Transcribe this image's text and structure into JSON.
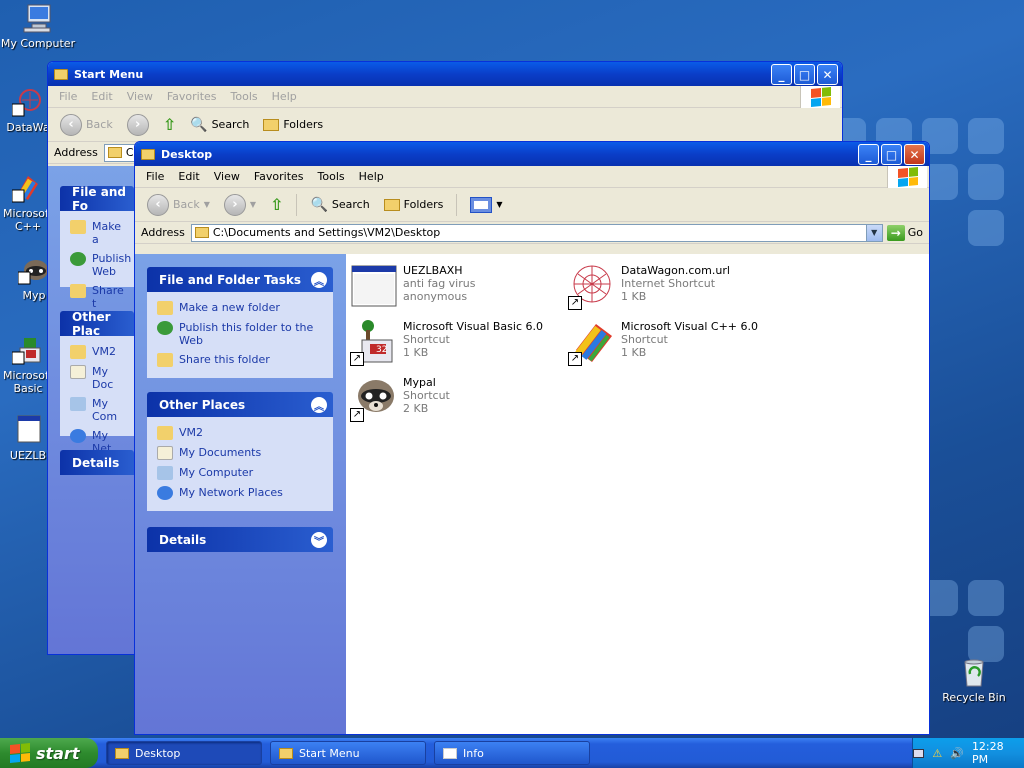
{
  "desktop": {
    "icons": [
      {
        "label": "My Computer"
      },
      {
        "label": "DataWa"
      },
      {
        "label": "Microsoft C++"
      },
      {
        "label": "Myp"
      },
      {
        "label": "Microsoft Basic"
      },
      {
        "label": "UEZLB"
      },
      {
        "label": "Recycle Bin"
      }
    ]
  },
  "startmenu_window": {
    "title": "Start Menu",
    "menu": [
      "File",
      "Edit",
      "View",
      "Favorites",
      "Tools",
      "Help"
    ],
    "toolbar": {
      "back": "Back",
      "search": "Search",
      "folders": "Folders"
    },
    "address_label": "Address",
    "address_value": "C:",
    "panes": {
      "file_tasks": "File and Fo",
      "items": [
        "Make a",
        "Publish Web",
        "Share t"
      ],
      "other_places": "Other Plac",
      "places": [
        "VM2",
        "My Doc",
        "My Com",
        "My Net"
      ],
      "details": "Details"
    }
  },
  "desktop_window": {
    "title": "Desktop",
    "menu": [
      "File",
      "Edit",
      "View",
      "Favorites",
      "Tools",
      "Help"
    ],
    "toolbar": {
      "back": "Back",
      "search": "Search",
      "folders": "Folders"
    },
    "address_label": "Address",
    "address_value": "C:\\Documents and Settings\\VM2\\Desktop",
    "go_label": "Go",
    "file_tasks": {
      "title": "File and Folder Tasks",
      "items": [
        "Make a new folder",
        "Publish this folder to the Web",
        "Share this folder"
      ]
    },
    "other_places": {
      "title": "Other Places",
      "items": [
        "VM2",
        "My Documents",
        "My Computer",
        "My Network Places"
      ]
    },
    "details": {
      "title": "Details"
    },
    "files": [
      {
        "name": "UEZLBAXH",
        "line2": "anti fag virus",
        "line3": "anonymous"
      },
      {
        "name": "DataWagon.com.url",
        "line2": "Internet Shortcut",
        "line3": "1 KB"
      },
      {
        "name": "Microsoft Visual Basic 6.0",
        "line2": "Shortcut",
        "line3": "1 KB"
      },
      {
        "name": "Microsoft Visual C++ 6.0",
        "line2": "Shortcut",
        "line3": "1 KB"
      },
      {
        "name": "Mypal",
        "line2": "Shortcut",
        "line3": "2 KB"
      }
    ]
  },
  "taskbar": {
    "start_label": "start",
    "items": [
      {
        "label": "Desktop"
      },
      {
        "label": "Start Menu"
      },
      {
        "label": "Info"
      }
    ],
    "clock": "12:28 PM"
  },
  "colors": {
    "title_blue": "#0a5be8",
    "taskpane_link": "#1c3aa8",
    "start_green": "#2e8b2e"
  }
}
